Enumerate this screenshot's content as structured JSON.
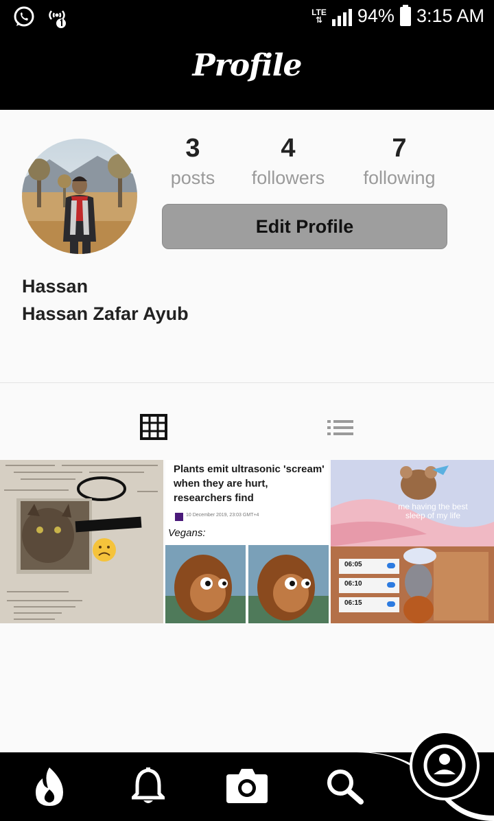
{
  "status_bar": {
    "network": "LTE",
    "battery": "94%",
    "time": "3:15 AM",
    "icons": [
      "whatsapp-icon",
      "hotspot-icon",
      "signal-icon",
      "battery-icon"
    ]
  },
  "header": {
    "title": "Profile"
  },
  "profile": {
    "stats": [
      {
        "value": "3",
        "label": "posts"
      },
      {
        "value": "4",
        "label": "followers"
      },
      {
        "value": "7",
        "label": "following"
      }
    ],
    "edit_button": "Edit Profile",
    "username": "Hassan",
    "full_name": "Hassan Zafar Ayub"
  },
  "tabs": {
    "icons": [
      "grid-icon",
      "list-icon"
    ],
    "active": "grid-icon"
  },
  "posts": [
    {
      "id": "post-1"
    },
    {
      "id": "post-2",
      "headline": "Plants emit ultrasonic 'scream' when they are hurt, researchers find",
      "meta": "10 December 2019, 23:03 GMT+4",
      "caption": "Vegans:"
    },
    {
      "id": "post-3",
      "caption": "me having the best sleep of my life",
      "alarms": [
        "06:05",
        "06:10",
        "06:15"
      ]
    }
  ],
  "bottom_nav": [
    "flame-icon",
    "bell-icon",
    "camera-icon",
    "search-icon",
    "profile-icon"
  ],
  "colors": {
    "bar": "#000000",
    "background": "#fafafa",
    "button": "#9e9e9e",
    "stat_label": "#9a9a9a"
  }
}
